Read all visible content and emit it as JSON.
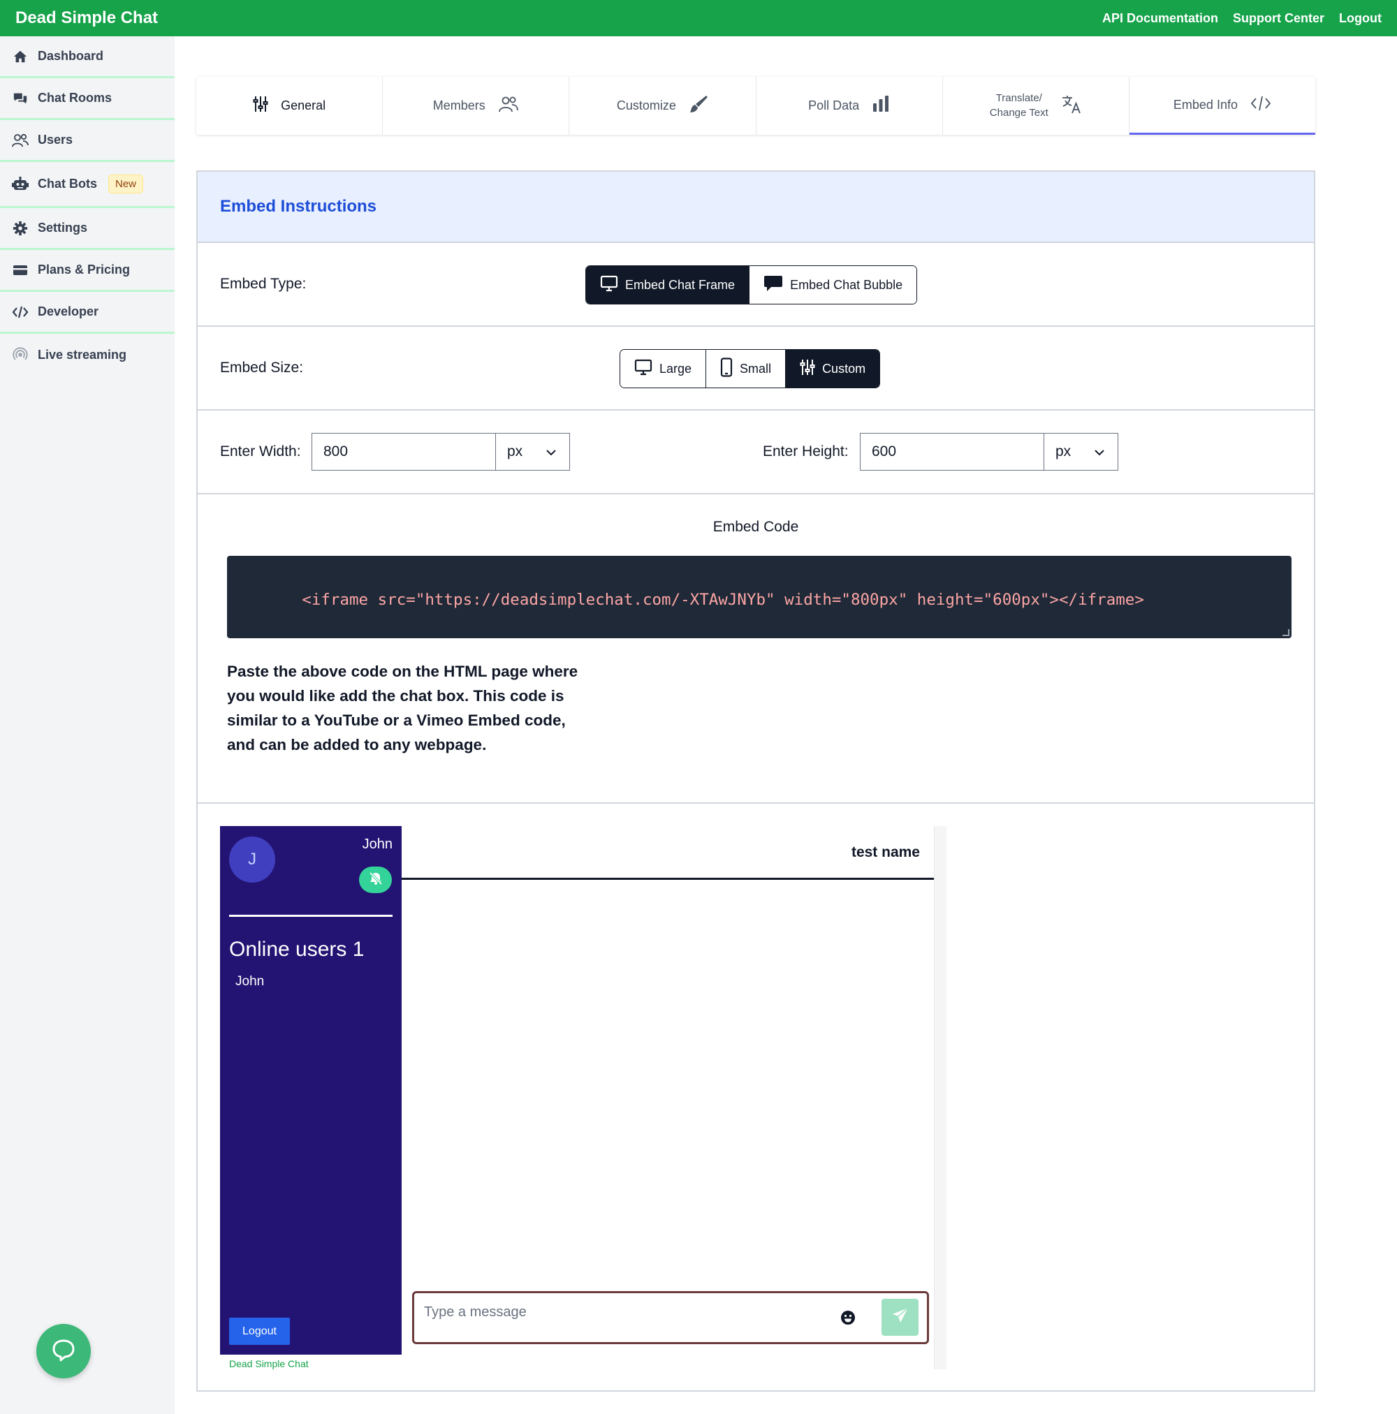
{
  "app": {
    "brand": "Dead Simple Chat"
  },
  "header": {
    "links": [
      "API Documentation",
      "Support Center",
      "Logout"
    ]
  },
  "sidebar": {
    "items": [
      {
        "label": "Dashboard"
      },
      {
        "label": "Chat Rooms"
      },
      {
        "label": "Users"
      },
      {
        "label": "Chat Bots",
        "badge": "New"
      },
      {
        "label": "Settings"
      },
      {
        "label": "Plans & Pricing"
      },
      {
        "label": "Developer"
      },
      {
        "label": "Live streaming"
      }
    ]
  },
  "tabs": [
    {
      "label": "General"
    },
    {
      "label": "Members"
    },
    {
      "label": "Customize"
    },
    {
      "label": "Poll Data"
    },
    {
      "label_line1": "Translate/",
      "label_line2": "Change Text"
    },
    {
      "label": "Embed Info",
      "active": true
    }
  ],
  "embed": {
    "heading": "Embed Instructions",
    "type_label": "Embed Type:",
    "type_options": [
      "Embed Chat Frame",
      "Embed Chat Bubble"
    ],
    "type_selected": "Embed Chat Frame",
    "size_label": "Embed Size:",
    "size_options": [
      "Large",
      "Small",
      "Custom"
    ],
    "size_selected": "Custom",
    "width_label": "Enter Width:",
    "width_value": "800",
    "width_unit": "px",
    "height_label": "Enter Height:",
    "height_value": "600",
    "height_unit": "px",
    "code_title": "Embed Code",
    "code": "<iframe src=\"https://deadsimplechat.com/-XTAwJNYb\" width=\"800px\" height=\"600px\"></iframe>",
    "note": "Paste the above code on the HTML page where you would like add the chat box. This code is similar to a YouTube or a Vimeo Embed code, and can be added to any webpage."
  },
  "preview": {
    "avatar_initial": "J",
    "username": "John",
    "online_label": "Online users 1",
    "online_users": [
      "John"
    ],
    "logout_label": "Logout",
    "footer": "Dead Simple Chat",
    "room_name": "test name",
    "message_placeholder": "Type a message"
  },
  "colors": {
    "topbar": "#16a34a",
    "chat_sidebar": "#231473",
    "accent_tab": "#6366f1",
    "heading_blue": "#1d4ed8"
  }
}
